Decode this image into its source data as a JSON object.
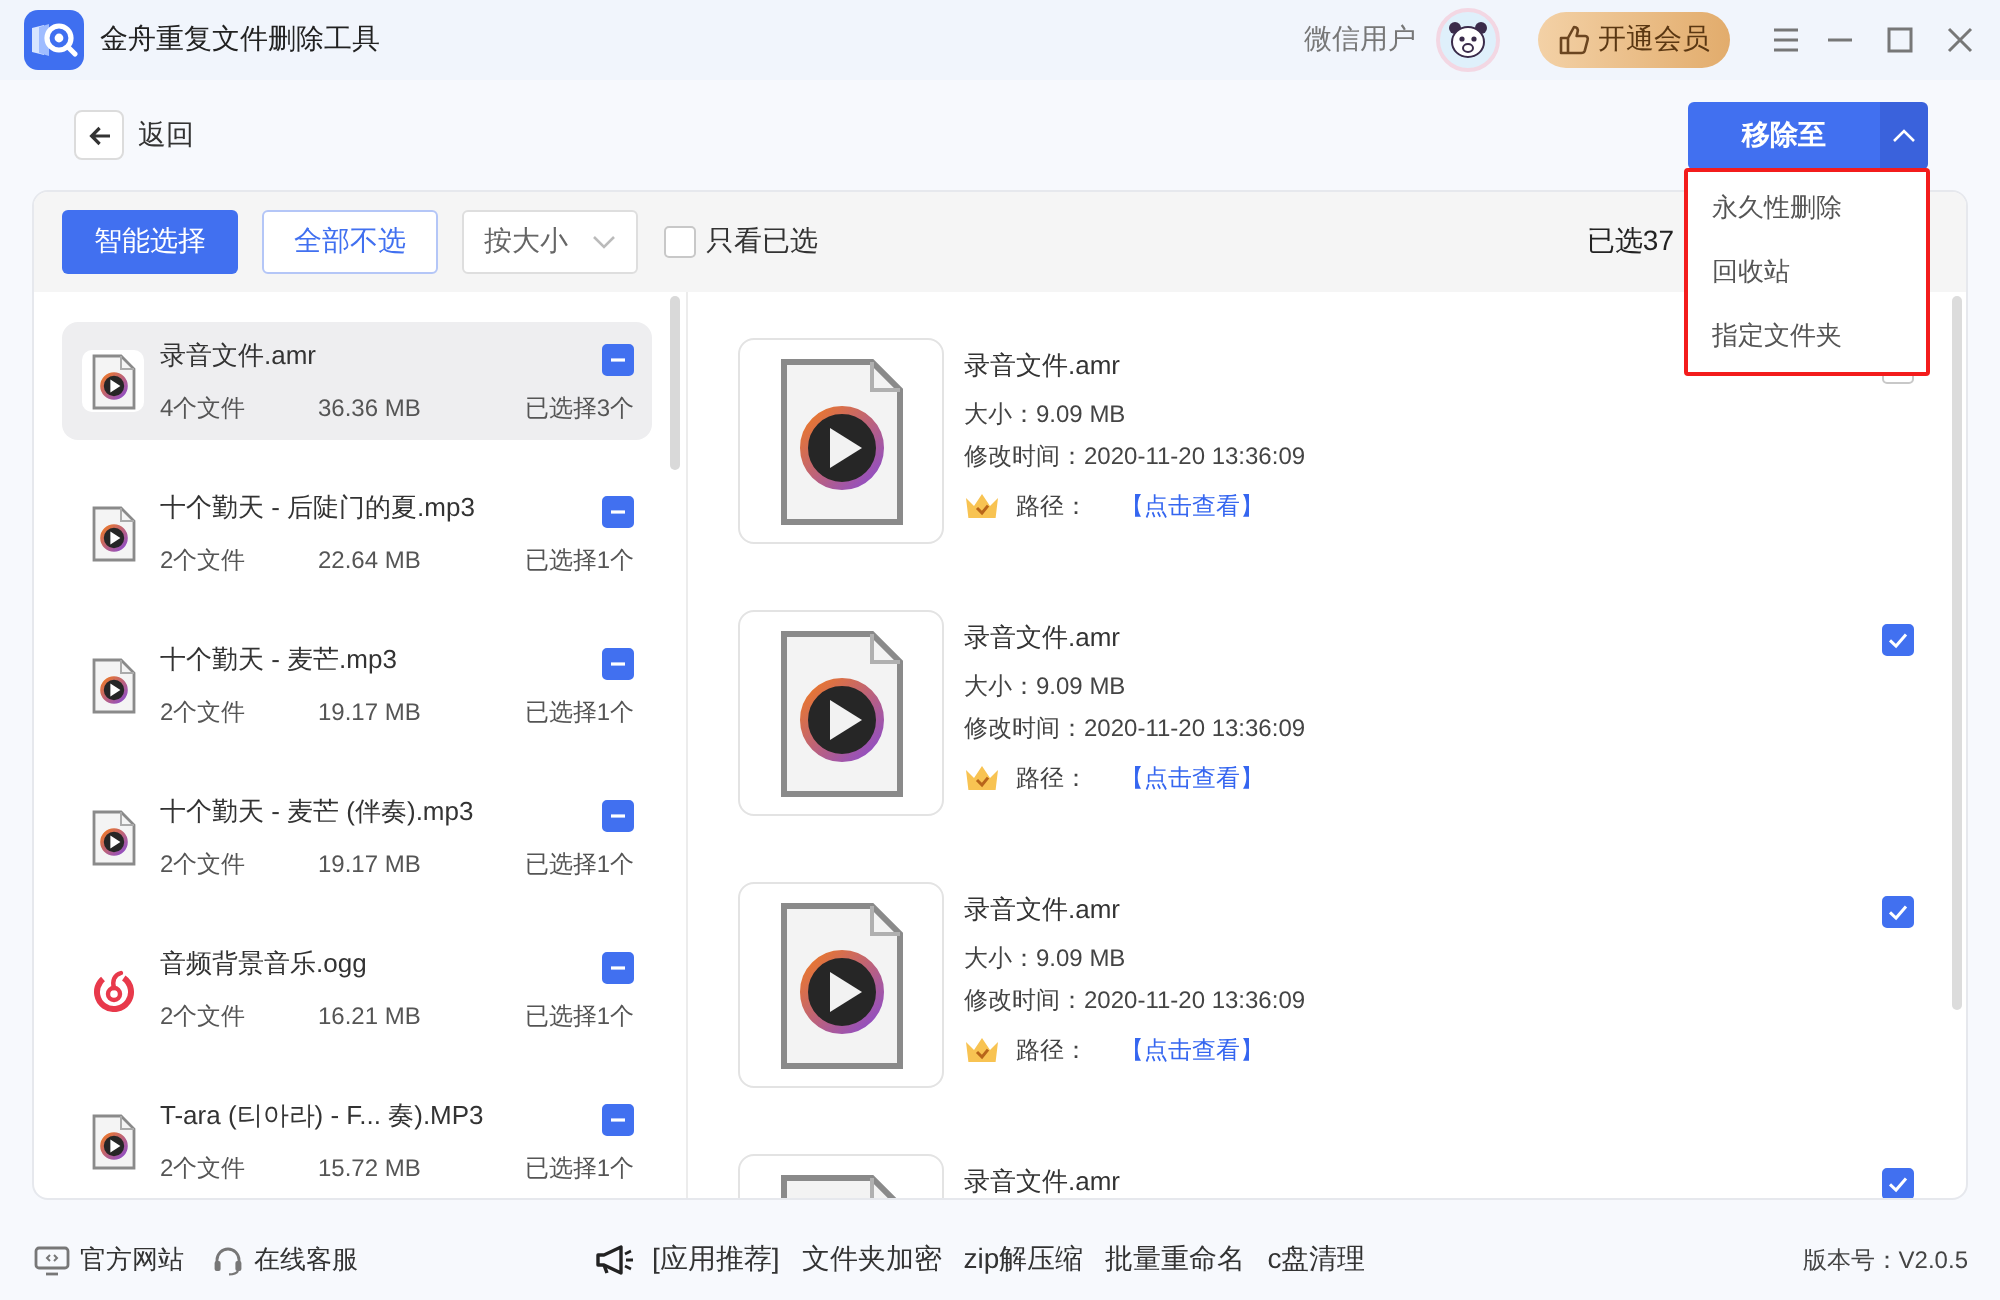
{
  "window": {
    "title": "金舟重复文件删除工具",
    "user_name": "微信用户",
    "vip_button": "开通会员"
  },
  "header": {
    "back_label": "返回",
    "move_button": "移除至",
    "menu_expanded": true,
    "menu_items": [
      "永久性删除",
      "回收站",
      "指定文件夹"
    ]
  },
  "toolbar": {
    "smart_select": "智能选择",
    "deselect_all": "全部不选",
    "sort": "按大小",
    "only_selected": {
      "label": "只看已选",
      "checked": false
    },
    "selected_count": "已选37"
  },
  "groups": [
    {
      "kind": "play",
      "name": "录音文件.amr",
      "count": "4个文件",
      "size": "36.36 MB",
      "picked": "已选择3个",
      "partial": true,
      "selected": true
    },
    {
      "kind": "play",
      "name": "十个勤天 - 后陡门的夏.mp3",
      "count": "2个文件",
      "size": "22.64 MB",
      "picked": "已选择1个",
      "partial": true,
      "selected": false
    },
    {
      "kind": "play",
      "name": "十个勤天 - 麦芒.mp3",
      "count": "2个文件",
      "size": "19.17 MB",
      "picked": "已选择1个",
      "partial": true,
      "selected": false
    },
    {
      "kind": "play",
      "name": "十个勤天 - 麦芒 (伴奏).mp3",
      "count": "2个文件",
      "size": "19.17 MB",
      "picked": "已选择1个",
      "partial": true,
      "selected": false
    },
    {
      "kind": "spiral",
      "name": "音频背景音乐.ogg",
      "count": "2个文件",
      "size": "16.21 MB",
      "picked": "已选择1个",
      "partial": true,
      "selected": false
    },
    {
      "kind": "play",
      "name": "T-ara (티아라) - F... 奏).MP3",
      "count": "2个文件",
      "size": "15.72 MB",
      "picked": "已选择1个",
      "partial": true,
      "selected": false
    }
  ],
  "files": [
    {
      "name": "录音文件.amr",
      "size": "大小：9.09 MB",
      "modified": "修改时间：2020-11-20 13:36:09",
      "path_label": "路径：",
      "path_link": "【点击查看】",
      "checked": false
    },
    {
      "name": "录音文件.amr",
      "size": "大小：9.09 MB",
      "modified": "修改时间：2020-11-20 13:36:09",
      "path_label": "路径：",
      "path_link": "【点击查看】",
      "checked": true
    },
    {
      "name": "录音文件.amr",
      "size": "大小：9.09 MB",
      "modified": "修改时间：2020-11-20 13:36:09",
      "path_label": "路径：",
      "path_link": "【点击查看】",
      "checked": true
    },
    {
      "name": "录音文件.amr",
      "checked": true
    }
  ],
  "footer": {
    "links": [
      {
        "kind": "monitor",
        "label": "官方网站"
      },
      {
        "kind": "headset",
        "label": "在线客服"
      }
    ],
    "promo_label": "[应用推荐]",
    "promo_links": [
      "文件夹加密",
      "zip解压缩",
      "批量重命名",
      "c盘清理"
    ],
    "version": "版本号：V2.0.5"
  }
}
